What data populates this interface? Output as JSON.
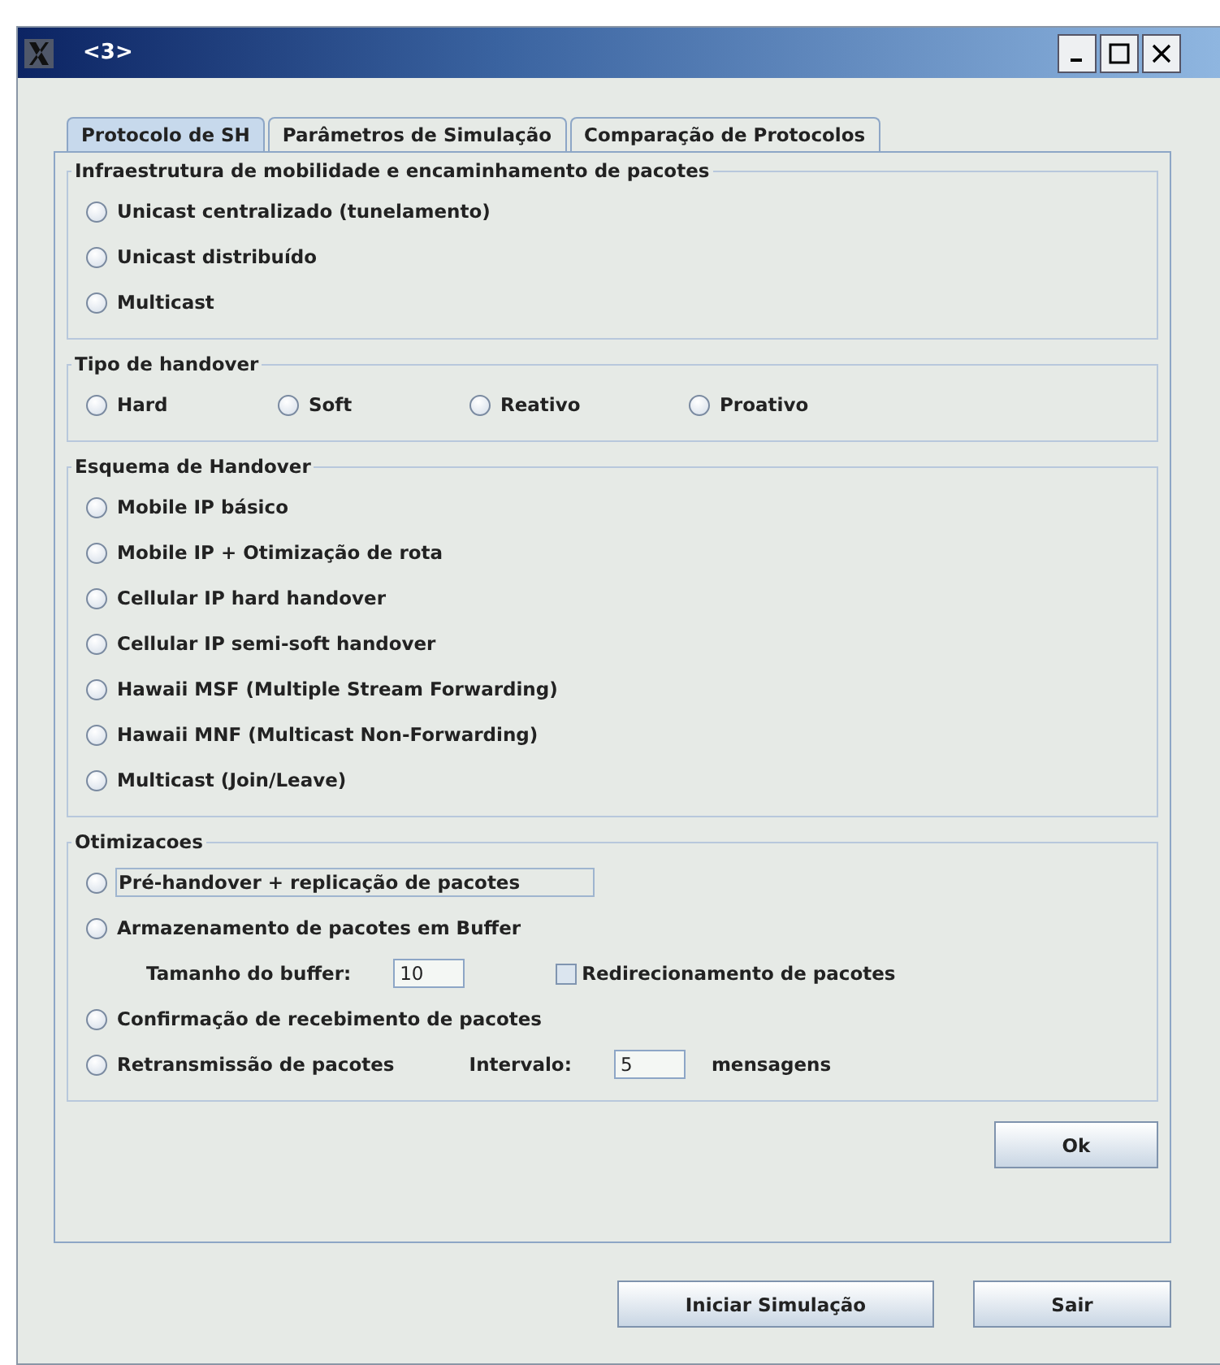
{
  "window": {
    "title": "<3>"
  },
  "tabs": [
    {
      "label": "Protocolo de SH",
      "selected": true
    },
    {
      "label": "Parâmetros de Simulação",
      "selected": false
    },
    {
      "label": "Comparação de Protocolos",
      "selected": false
    }
  ],
  "groups": [
    {
      "title": "Infraestrutura de mobilidade e encaminhamento de pacotes",
      "kind": "column",
      "items": [
        {
          "kind": "radio",
          "label": "Unicast centralizado (tunelamento)",
          "selected": false
        },
        {
          "kind": "radio",
          "label": "Unicast distribuído",
          "selected": false
        },
        {
          "kind": "radio",
          "label": "Multicast",
          "selected": false
        }
      ]
    },
    {
      "title": "Tipo de handover",
      "kind": "row",
      "items": [
        {
          "kind": "radio",
          "label": "Hard",
          "selected": false
        },
        {
          "kind": "radio",
          "label": "Soft",
          "selected": false
        },
        {
          "kind": "radio",
          "label": "Reativo",
          "selected": false
        },
        {
          "kind": "radio",
          "label": "Proativo",
          "selected": false
        }
      ]
    },
    {
      "title": "Esquema de Handover",
      "kind": "column",
      "items": [
        {
          "kind": "radio",
          "label": "Mobile IP básico",
          "selected": false
        },
        {
          "kind": "radio",
          "label": "Mobile IP + Otimização de rota",
          "selected": false
        },
        {
          "kind": "radio",
          "label": "Cellular IP hard handover",
          "selected": false
        },
        {
          "kind": "radio",
          "label": "Cellular IP semi-soft handover",
          "selected": false
        },
        {
          "kind": "radio",
          "label": "Hawaii MSF (Multiple Stream Forwarding)",
          "selected": false
        },
        {
          "kind": "radio",
          "label": "Hawaii MNF (Multicast Non-Forwarding)",
          "selected": false
        },
        {
          "kind": "radio",
          "label": "Multicast (Join/Leave)",
          "selected": false
        }
      ]
    },
    {
      "title": "Otimizacoes",
      "kind": "column",
      "items": [
        {
          "kind": "radio",
          "label": "Pré-handover + replicação de pacotes",
          "selected": false,
          "focused": true
        },
        {
          "kind": "radio",
          "label": "Armazenamento de pacotes em Buffer",
          "selected": false
        },
        {
          "kind": "settings",
          "label": "Tamanho do buffer:",
          "value": "10",
          "checkbox": {
            "label": "Redirecionamento de pacotes",
            "checked": false
          }
        },
        {
          "kind": "radio",
          "label": "Confirmação de recebimento de pacotes",
          "selected": false
        },
        {
          "kind": "radio",
          "label": "Retransmissão de pacotes",
          "selected": false,
          "field": {
            "label": "Intervalo:",
            "value": "5",
            "unit": "mensagens"
          }
        }
      ]
    }
  ],
  "panel_button": "Ok",
  "buttons": [
    "Iniciar Simulação",
    "Sair"
  ]
}
